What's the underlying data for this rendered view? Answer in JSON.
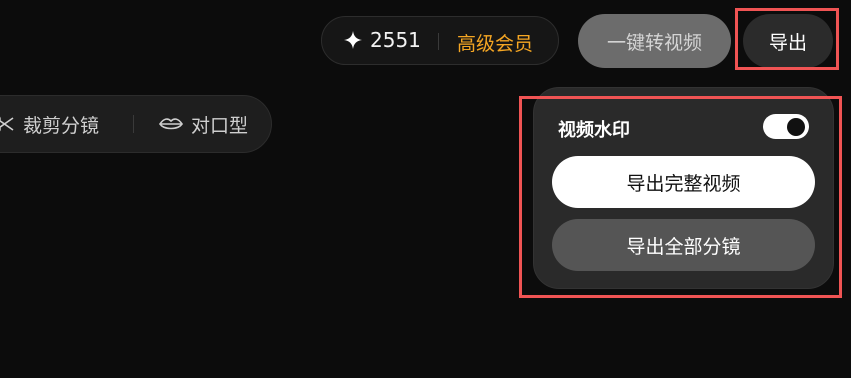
{
  "toolbar": {
    "items": [
      {
        "label": "裁剪分镜",
        "icon": "scissors-icon"
      },
      {
        "label": "对口型",
        "icon": "lips-icon"
      }
    ]
  },
  "header": {
    "credits": {
      "count": "2551",
      "icon": "sparkle-star-icon"
    },
    "member_label": "高级会员",
    "convert_label": "一键转视频",
    "export_label": "导出"
  },
  "export_panel": {
    "watermark_label": "视频水印",
    "watermark_enabled": true,
    "export_full_label": "导出完整视频",
    "export_segments_label": "导出全部分镜"
  },
  "colors": {
    "background": "#0c0c0c",
    "member_accent": "#f5a623",
    "highlight": "#f05454"
  }
}
